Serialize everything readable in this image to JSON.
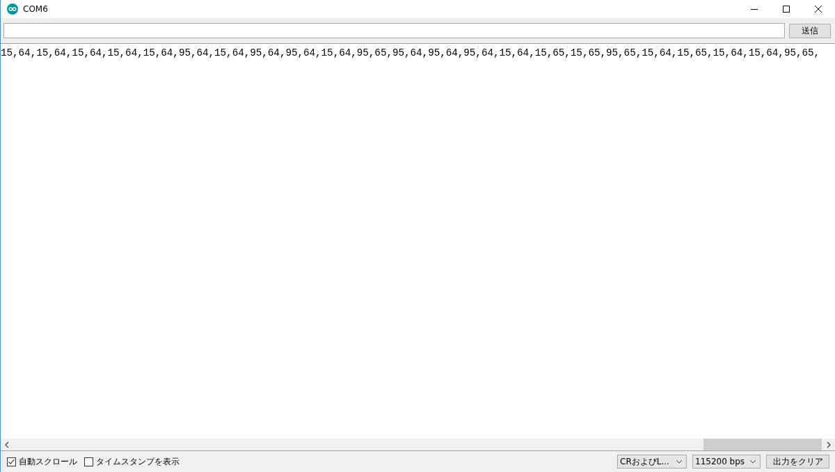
{
  "window": {
    "title": "COM6"
  },
  "send": {
    "button": "送信"
  },
  "output": {
    "text": "15,64,15,64,15,64,15,64,15,64,95,64,15,64,95,64,95,64,15,64,95,65,95,64,95,64,95,64,15,64,15,65,15,65,95,65,15,64,15,65,15,64,15,64,95,65,"
  },
  "options": [
    {
      "label": "自動スクロール",
      "checked": true
    },
    {
      "label": "タイムスタンプを表示",
      "checked": false
    }
  ],
  "line_ending": "CRおよびL...",
  "baud_rate": "115200 bps",
  "clear_button": "出力をクリア"
}
